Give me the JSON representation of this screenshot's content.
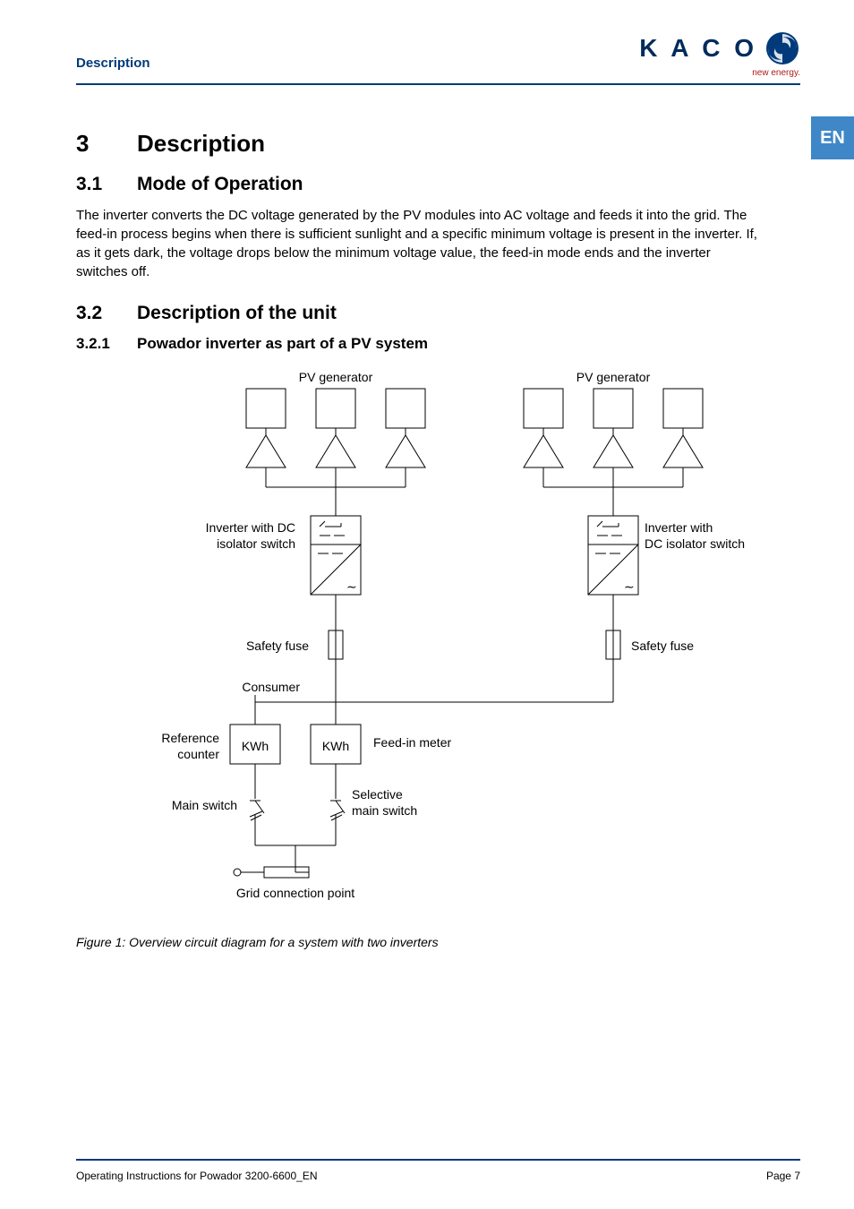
{
  "header": {
    "running_title": "Description"
  },
  "brand": {
    "name": "K A C O",
    "tagline": "new energy."
  },
  "lang_tab": "EN",
  "section": {
    "num": "3",
    "title": "Description"
  },
  "sub1": {
    "num": "3.1",
    "title": "Mode of Operation",
    "body": "The inverter converts the DC voltage generated by the PV modules into AC voltage and feeds it into the grid. The feed-in process begins when there is sufficient sunlight and a specific minimum voltage is present in the inverter. If, as it gets dark, the voltage drops below the minimum voltage value, the feed-in mode ends and the inverter switches off."
  },
  "sub2": {
    "num": "3.2",
    "title": "Description of the unit"
  },
  "sub21": {
    "num": "3.2.1",
    "title": "Powador inverter as part of a PV system"
  },
  "diagram": {
    "labels": {
      "pv_generator": "PV generator",
      "inverter_dc_isolator_1": "Inverter with DC isolator switch",
      "inverter_dc_isolator_2": "Inverter with DC isolator switch",
      "safety_fuse": "Safety fuse",
      "consumer": "Consumer",
      "reference_counter": "Reference counter",
      "feed_in_meter": "Feed-in meter",
      "kwh": "KWh",
      "main_switch": "Main switch",
      "selective_main_switch": "Selective main switch",
      "grid_connection_point": "Grid connection point"
    }
  },
  "figure_caption": "Figure 1:   Overview circuit diagram for a system with two inverters",
  "footer": {
    "doc": "Operating Instructions for Powador 3200-6600_EN",
    "page": "Page 7"
  }
}
